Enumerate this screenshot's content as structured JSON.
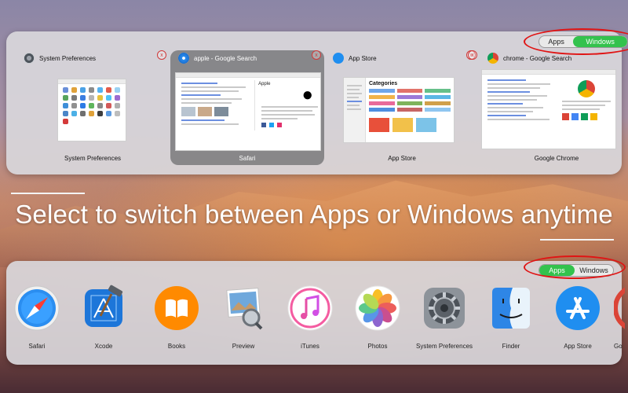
{
  "window_switcher": {
    "toggle": {
      "apps_label": "Apps",
      "windows_label": "Windows",
      "active": "Windows"
    },
    "windows": [
      {
        "app_title": "System Preferences",
        "footer": "System Preferences",
        "icon": "gear-icon"
      },
      {
        "app_title": "apple - Google Search",
        "footer": "Safari",
        "icon": "compass-icon",
        "selected": true
      },
      {
        "app_title": "App Store",
        "footer": "App Store",
        "icon": "app-store-icon"
      },
      {
        "app_title": "chrome - Google Search",
        "footer": "Google Chrome",
        "icon": "chrome-icon"
      }
    ],
    "close_glyph": "x"
  },
  "caption": {
    "text": "Select to switch between Apps or Windows anytime"
  },
  "app_switcher": {
    "toggle": {
      "apps_label": "Apps",
      "windows_label": "Windows",
      "active": "Apps"
    },
    "apps": [
      {
        "label": "Safari",
        "icon": "compass-icon"
      },
      {
        "label": "Xcode",
        "icon": "hammer-blueprint-icon"
      },
      {
        "label": "Books",
        "icon": "book-icon"
      },
      {
        "label": "Preview",
        "icon": "photo-loupe-icon"
      },
      {
        "label": "iTunes",
        "icon": "music-note-icon"
      },
      {
        "label": "Photos",
        "icon": "flower-icon"
      },
      {
        "label": "System Preferences",
        "icon": "gear-icon"
      },
      {
        "label": "Finder",
        "icon": "finder-face-icon"
      },
      {
        "label": "App Store",
        "icon": "app-store-icon"
      },
      {
        "label": "Go",
        "icon": "chrome-icon"
      }
    ]
  },
  "colors": {
    "toggle_active": "#33c24d",
    "highlight_ring": "#e01414",
    "caption_text": "#ffffff"
  }
}
